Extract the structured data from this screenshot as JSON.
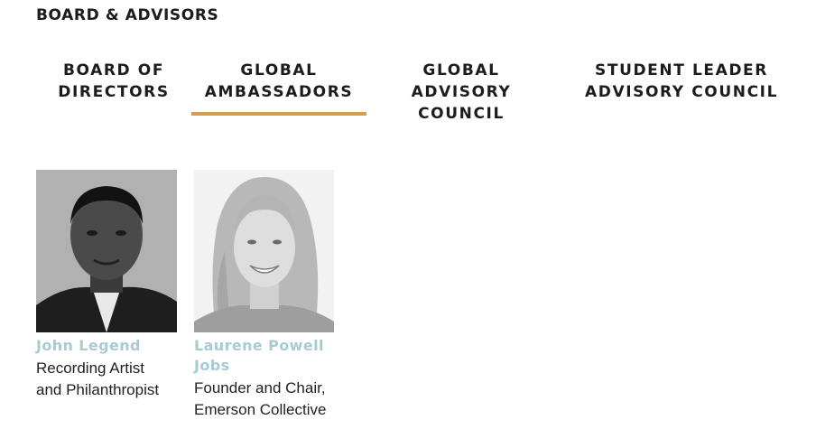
{
  "section": {
    "title": "BOARD & ADVISORS"
  },
  "tabs": [
    {
      "label": "BOARD OF\nDIRECTORS",
      "active": false
    },
    {
      "label": "GLOBAL\nAMBASSADORS",
      "active": true
    },
    {
      "label": "GLOBAL\nADVISORY\nCOUNCIL",
      "active": false
    },
    {
      "label": "STUDENT LEADER\nADVISORY COUNCIL",
      "active": false
    }
  ],
  "colors": {
    "active_underline": "#d69e4e",
    "name_link": "#a8cbd3"
  },
  "people": [
    {
      "name": "John Legend",
      "role": "Recording Artist\nand Philanthropist",
      "photo": "portrait-photo"
    },
    {
      "name": "Laurene Powell\nJobs",
      "role": "Founder and Chair,\nEmerson Collective",
      "photo": "portrait-photo"
    }
  ]
}
